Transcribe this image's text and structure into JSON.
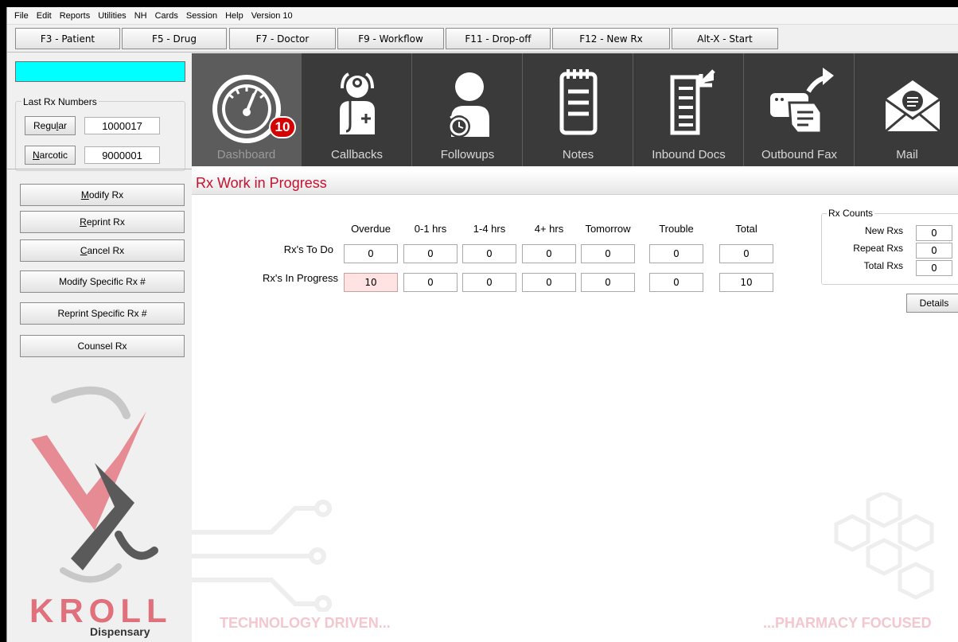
{
  "menu": [
    "File",
    "Edit",
    "Reports",
    "Utilities",
    "NH",
    "Cards",
    "Session",
    "Help",
    "Version 10"
  ],
  "fkeys": [
    "F3 - Patient",
    "F5 - Drug",
    "F7 - Doctor",
    "F9 - Workflow",
    "F11 - Drop-off",
    "F12 - New Rx",
    "Alt-X - Start"
  ],
  "left": {
    "last_rx_title": "Last Rx Numbers",
    "regular": {
      "pre": "Regu",
      "key": "l",
      "post": "ar",
      "value": "1000017"
    },
    "narcotic": {
      "pre": "",
      "key": "N",
      "post": "arcotic",
      "value": "9000001"
    },
    "buttons": [
      {
        "pre": "",
        "key": "M",
        "post": "odify Rx"
      },
      {
        "pre": "",
        "key": "R",
        "post": "eprint Rx"
      },
      {
        "pre": "",
        "key": "C",
        "post": "ancel Rx"
      },
      {
        "pre": "Modify Specific Rx #",
        "key": "",
        "post": ""
      },
      {
        "pre": "Reprint Specific Rx #",
        "key": "",
        "post": ""
      },
      {
        "pre": "Counsel Rx",
        "key": "",
        "post": ""
      }
    ],
    "brand": "KROLL",
    "brand_sub": "Dispensary",
    "brand_color": "#e0707c"
  },
  "tiles": [
    {
      "label": "Dashboard",
      "icon": "dashboard-gauge-icon",
      "badge": "10",
      "active": true
    },
    {
      "label": "Callbacks",
      "icon": "doctor-icon"
    },
    {
      "label": "Followups",
      "icon": "person-alarm-icon"
    },
    {
      "label": "Notes",
      "icon": "notepad-icon"
    },
    {
      "label": "Inbound Docs",
      "icon": "inbound-document-icon"
    },
    {
      "label": "Outbound Fax",
      "icon": "fax-icon"
    },
    {
      "label": "Mail",
      "icon": "mail-icon"
    }
  ],
  "main": {
    "title": "Rx Work in Progress",
    "title_color": "#c8102e",
    "columns": [
      "Overdue",
      "0-1 hrs",
      "1-4 hrs",
      "4+ hrs",
      "Tomorrow",
      "Trouble",
      "Total"
    ],
    "rows": [
      {
        "label": "Rx's To Do",
        "values": [
          "0",
          "0",
          "0",
          "0",
          "0",
          "0",
          "0"
        ]
      },
      {
        "label": "Rx's In Progress",
        "values": [
          "10",
          "0",
          "0",
          "0",
          "0",
          "0",
          "10"
        ]
      }
    ],
    "rx_counts": {
      "title": "Rx Counts",
      "items": [
        {
          "label": "New Rxs",
          "value": "0"
        },
        {
          "label": "Repeat Rxs",
          "value": "0"
        },
        {
          "label": "Total Rxs",
          "value": "0"
        }
      ]
    },
    "details_label": "Details",
    "tagline_left": "TECHNOLOGY DRIVEN...",
    "tagline_right": "...PHARMACY FOCUSED"
  }
}
